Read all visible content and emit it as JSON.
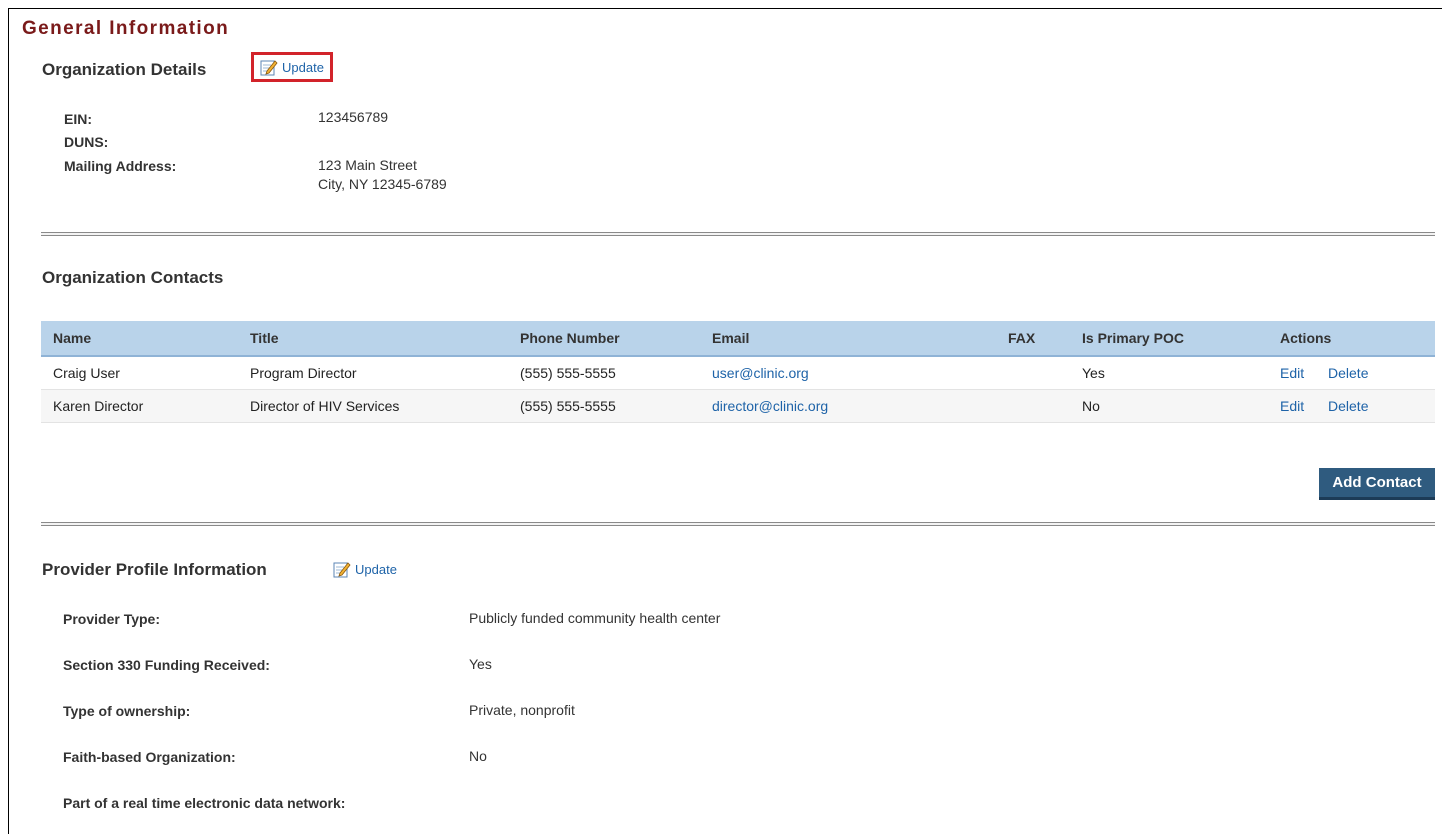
{
  "page": {
    "title": "General Information"
  },
  "org_details": {
    "title": "Organization Details",
    "update_label": "Update",
    "fields": [
      {
        "label": "EIN:",
        "value": "123456789"
      },
      {
        "label": "DUNS:",
        "value": ""
      },
      {
        "label": "Mailing Address:",
        "value_line1": "123 Main Street",
        "value_line2": "City, NY 12345-6789"
      }
    ]
  },
  "contacts": {
    "title": "Organization Contacts",
    "columns": [
      "Name",
      "Title",
      "Phone Number",
      "Email",
      "FAX",
      "Is Primary POC",
      "Actions"
    ],
    "rows": [
      {
        "name": "Craig User",
        "title": "Program Director",
        "phone": "(555) 555-5555",
        "email": "user@clinic.org",
        "fax": "",
        "primary": "Yes",
        "edit": "Edit",
        "delete": "Delete"
      },
      {
        "name": "Karen Director",
        "title": "Director of HIV Services",
        "phone": "(555) 555-5555",
        "email": "director@clinic.org",
        "fax": "",
        "primary": "No",
        "edit": "Edit",
        "delete": "Delete"
      }
    ],
    "add_label": "Add Contact"
  },
  "provider": {
    "title": "Provider Profile Information",
    "update_label": "Update",
    "fields": [
      {
        "label": "Provider Type:",
        "value": "Publicly funded community health center"
      },
      {
        "label": "Section 330 Funding Received:",
        "value": "Yes"
      },
      {
        "label": "Type of ownership:",
        "value": "Private, nonprofit"
      },
      {
        "label": "Faith-based Organization:",
        "value": "No"
      },
      {
        "label": "Part of a real time electronic data network:",
        "value": ""
      }
    ]
  },
  "colors": {
    "title": "#7a1a1a",
    "link": "#1e63a8",
    "header_bg": "#b9d3ea",
    "button": "#2f5b7f",
    "highlight": "#d2232a"
  },
  "icons": {
    "update": "pencil-edit-icon"
  }
}
